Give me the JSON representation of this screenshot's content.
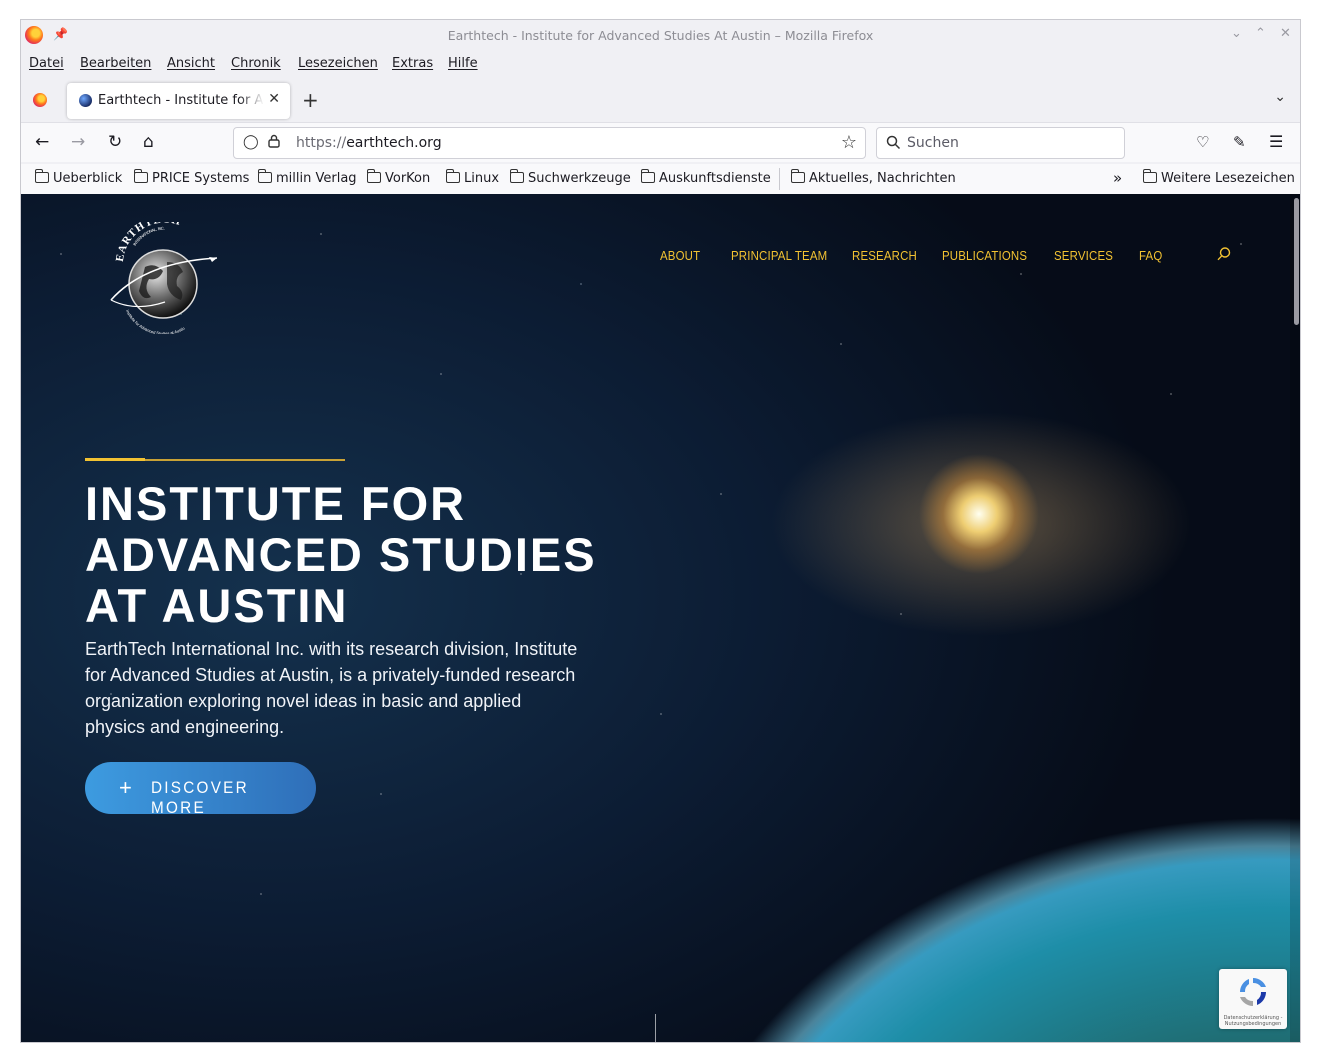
{
  "window": {
    "title": "Earthtech - Institute for Advanced Studies At Austin – Mozilla Firefox"
  },
  "menu": [
    "Datei",
    "Bearbeiten",
    "Ansicht",
    "Chronik",
    "Lesezeichen",
    "Extras",
    "Hilfe"
  ],
  "tab": {
    "label": "Earthtech - Institute for Advanced Studies At Austin"
  },
  "urlbar": {
    "protocol": "https://",
    "domain": "earthtech.org"
  },
  "search": {
    "placeholder": "Suchen"
  },
  "bookmarks": [
    "Ueberblick",
    "PRICE Systems",
    "millin Verlag",
    "VorKon",
    "Linux",
    "Suchwerkzeuge",
    "Auskunftsdienste",
    "Aktuelles, Nachrichten"
  ],
  "bookmarks_more": "Weitere Lesezeichen",
  "site": {
    "logo_top": "EARTHTECH",
    "logo_sub": "INTERNATIONAL, INC.",
    "logo_bottom": "Institute for Advanced Studies at Austin",
    "nav": [
      "ABOUT",
      "PRINCIPAL TEAM",
      "RESEARCH",
      "PUBLICATIONS",
      "SERVICES",
      "FAQ"
    ],
    "hero_title_lines": [
      "INSTITUTE FOR",
      "ADVANCED STUDIES",
      "AT AUSTIN"
    ],
    "hero_text": "EarthTech International Inc. with its research division, Institute for Advanced Studies at Austin, is a privately-funded research organization exploring novel ideas in basic and applied physics and engineering.",
    "cta": "DISCOVER MORE",
    "accent_color": "#f2c232",
    "button_color": "#3d9be0"
  },
  "recaptcha": {
    "text": "Datenschutzerklärung - Nutzungsbedingungen"
  }
}
